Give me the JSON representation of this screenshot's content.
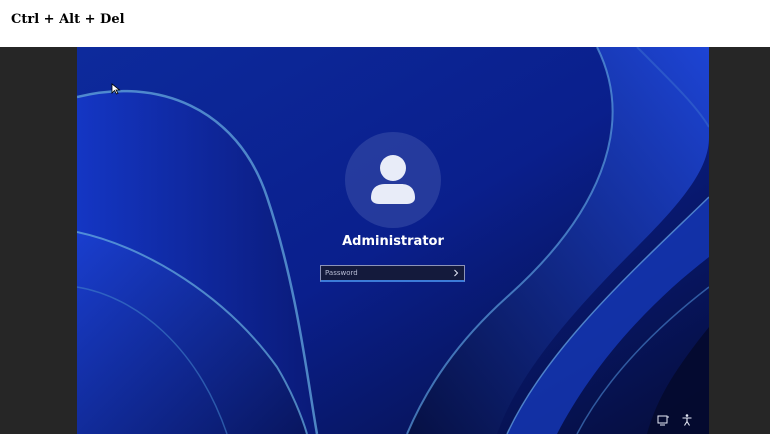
{
  "toolbar": {
    "ctrl_alt_del_label": "Ctrl + Alt + Del"
  },
  "login": {
    "username": "Administrator",
    "password": {
      "value": "",
      "placeholder": "Password"
    },
    "submit_icon": "arrow-right-icon"
  },
  "tray": {
    "icons": [
      "network-icon",
      "accessibility-icon"
    ]
  },
  "colors": {
    "wallpaper_base": "#0a1f8c",
    "input_accent": "#3c7bd8",
    "viewer_background": "#262626"
  }
}
